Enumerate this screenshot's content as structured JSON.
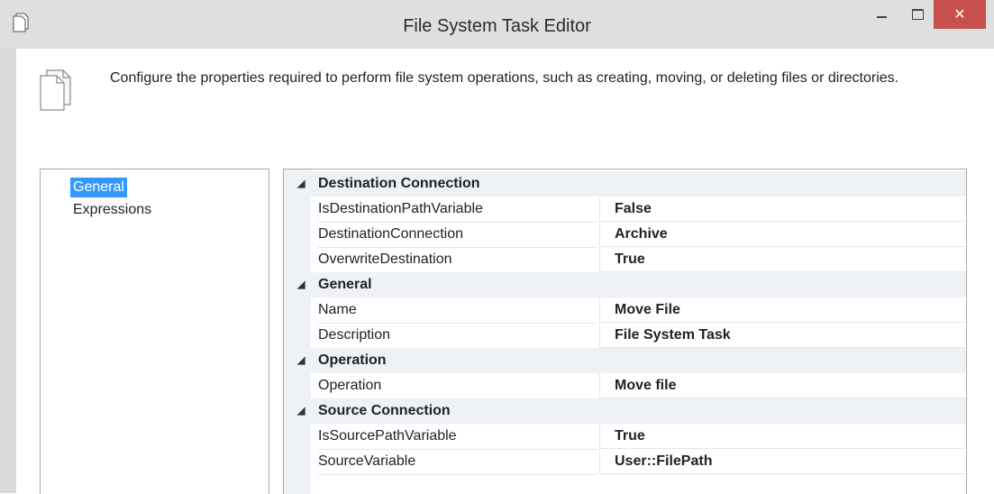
{
  "window": {
    "title": "File System Task Editor",
    "close_glyph": "✕"
  },
  "header": {
    "description": "Configure the properties required to perform file system operations, such as creating, moving, or deleting files or directories.",
    "icon": "file-copy-icon"
  },
  "nav": {
    "items": [
      {
        "label": "General",
        "selected": true
      },
      {
        "label": "Expressions",
        "selected": false
      }
    ]
  },
  "grid": {
    "rows": [
      {
        "type": "category",
        "label": "Destination Connection"
      },
      {
        "type": "prop",
        "name": "IsDestinationPathVariable",
        "value": "False"
      },
      {
        "type": "prop",
        "name": "DestinationConnection",
        "value": "Archive"
      },
      {
        "type": "prop",
        "name": "OverwriteDestination",
        "value": "True"
      },
      {
        "type": "category",
        "label": "General"
      },
      {
        "type": "prop",
        "name": "Name",
        "value": "Move File"
      },
      {
        "type": "prop",
        "name": "Description",
        "value": "File System Task"
      },
      {
        "type": "category",
        "label": "Operation"
      },
      {
        "type": "prop",
        "name": "Operation",
        "value": "Move file"
      },
      {
        "type": "category",
        "label": "Source Connection"
      },
      {
        "type": "prop",
        "name": "IsSourcePathVariable",
        "value": "True"
      },
      {
        "type": "prop",
        "name": "SourceVariable",
        "value": "User::FilePath"
      }
    ],
    "collapse_glyph": "◢"
  },
  "colors": {
    "selection": "#3399ff",
    "close_button": "#c7504c",
    "category_band": "#eef1f6"
  }
}
